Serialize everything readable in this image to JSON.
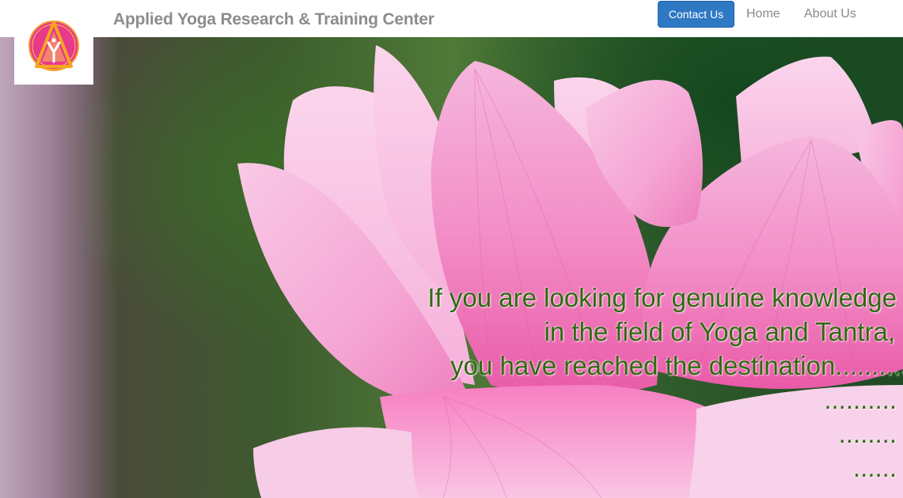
{
  "header": {
    "site_title": "Applied Yoga Research & Training Center",
    "nav": {
      "contact": "Contact Us",
      "home": "Home",
      "about": "About Us"
    }
  },
  "hero": {
    "lines": [
      "If you are looking for genuine knowledge",
      "in the field of Yoga and Tantra,",
      "you have reached the destination..........",
      "..........",
      "........",
      "......"
    ]
  },
  "logo": {
    "icon": "yoga-center-logo-icon"
  },
  "colors": {
    "contact_button": "#2f78c4",
    "title_gray": "#8c8c8c",
    "hero_text_green": "#2f6a10",
    "lotus_pink": "#f06ab4"
  }
}
